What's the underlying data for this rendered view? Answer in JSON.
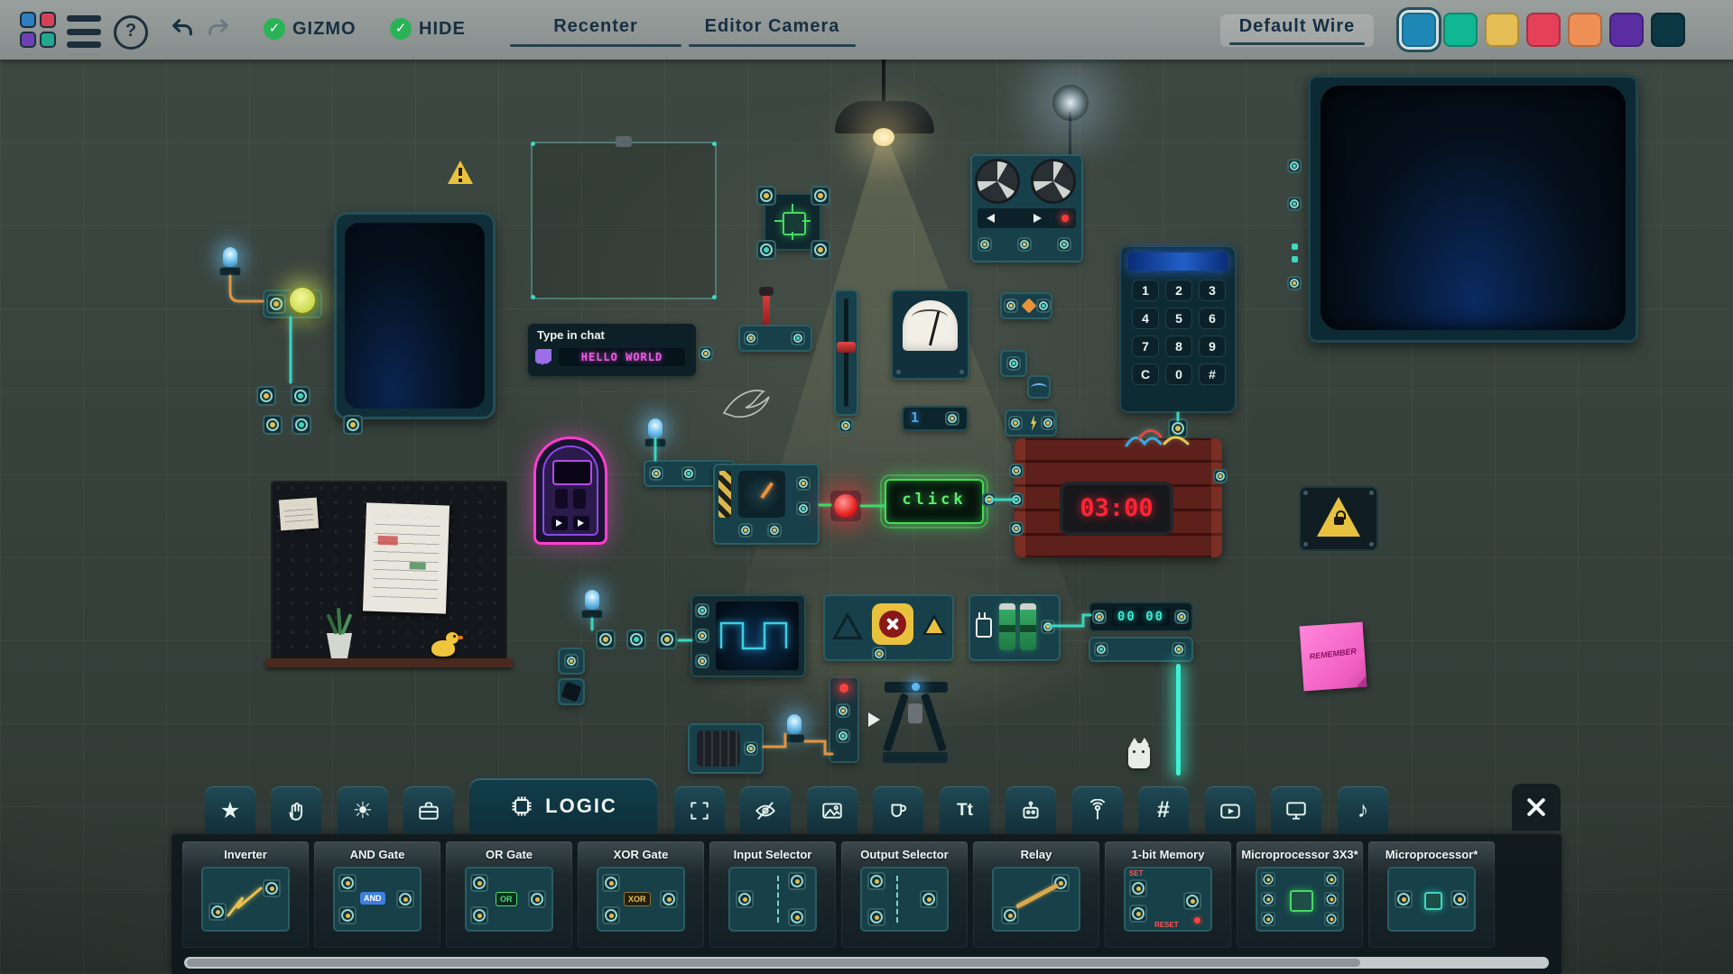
{
  "toolbar": {
    "gizmo": "GIZMO",
    "hide": "HIDE",
    "recenter": "Recenter",
    "editor_camera": "Editor Camera",
    "default_wire": "Default Wire",
    "help_glyph": "?",
    "check_glyph": "✓",
    "wire_colors": [
      "#1f87b5",
      "#10b793",
      "#e5bd55",
      "#e54059",
      "#ee8f55",
      "#5a2da2",
      "#0b3742"
    ]
  },
  "stage": {
    "chat_title": "Type in chat",
    "chat_message": "HELLO WORLD",
    "click_label": "click",
    "bomb_timer": "03:00",
    "counter_display": "00 00",
    "sticky_note": "REMEMBER",
    "meter_display": "1",
    "keypad_keys": [
      "1",
      "2",
      "3",
      "4",
      "5",
      "6",
      "7",
      "8",
      "9",
      "C",
      "0",
      "#"
    ]
  },
  "tabs": {
    "star_glyph": "★",
    "sun_glyph": "☀",
    "text_glyph": "Tt",
    "hash_glyph": "#",
    "music_glyph": "♪",
    "logic_label": "LOGIC"
  },
  "palette": {
    "items": [
      {
        "label": "Inverter"
      },
      {
        "label": "AND Gate",
        "badge": "AND"
      },
      {
        "label": "OR Gate",
        "badge": "OR"
      },
      {
        "label": "XOR Gate",
        "badge": "XOR"
      },
      {
        "label": "Input Selector"
      },
      {
        "label": "Output Selector"
      },
      {
        "label": "Relay"
      },
      {
        "label": "1-bit Memory",
        "set_label": "SET",
        "reset_label": "RESET"
      },
      {
        "label": "Microprocessor 3X3*"
      },
      {
        "label": "Microprocessor*"
      }
    ]
  }
}
